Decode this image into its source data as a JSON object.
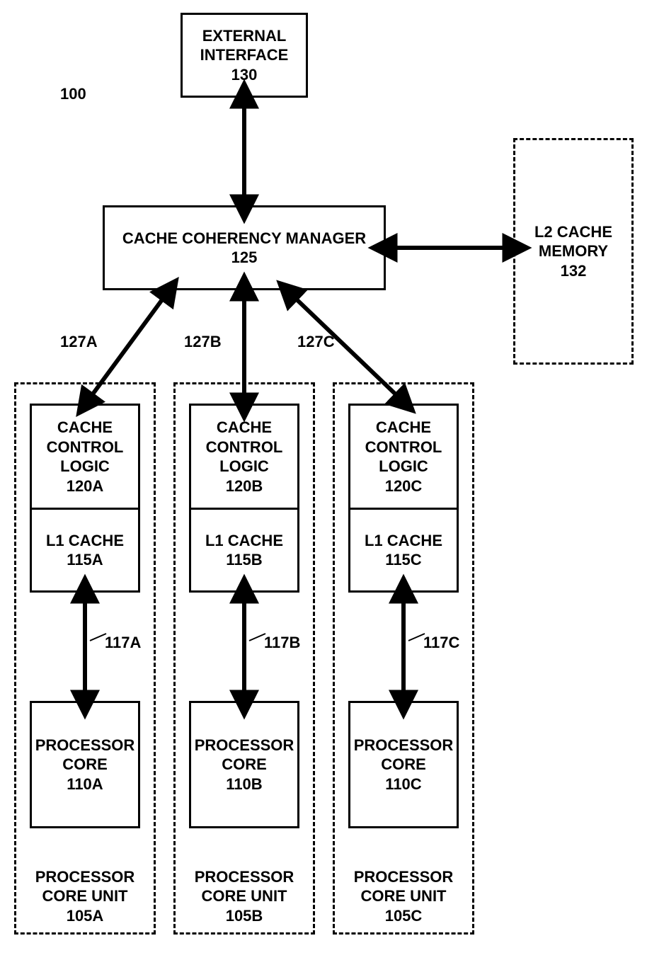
{
  "diagram_id": "100",
  "blocks": {
    "external_interface": {
      "title": "EXTERNAL INTERFACE",
      "ref": "130"
    },
    "cache_coherency_manager": {
      "title": "CACHE COHERENCY MANAGER",
      "ref": "125"
    },
    "l2_cache": {
      "title": "L2 CACHE MEMORY",
      "ref": "132"
    },
    "units": [
      {
        "cache_control": {
          "title": "CACHE CONTROL LOGIC",
          "ref": "120A"
        },
        "l1_cache": {
          "title": "L1 CACHE",
          "ref": "115A"
        },
        "processor_core": {
          "title": "PROCESSOR CORE",
          "ref": "110A"
        },
        "unit": {
          "title": "PROCESSOR CORE UNIT",
          "ref": "105A"
        },
        "arrow_top": "127A",
        "arrow_mid": "117A"
      },
      {
        "cache_control": {
          "title": "CACHE CONTROL LOGIC",
          "ref": "120B"
        },
        "l1_cache": {
          "title": "L1 CACHE",
          "ref": "115B"
        },
        "processor_core": {
          "title": "PROCESSOR CORE",
          "ref": "110B"
        },
        "unit": {
          "title": "PROCESSOR CORE UNIT",
          "ref": "105B"
        },
        "arrow_top": "127B",
        "arrow_mid": "117B"
      },
      {
        "cache_control": {
          "title": "CACHE CONTROL LOGIC",
          "ref": "120C"
        },
        "l1_cache": {
          "title": "L1 CACHE",
          "ref": "115C"
        },
        "processor_core": {
          "title": "PROCESSOR CORE",
          "ref": "110C"
        },
        "unit": {
          "title": "PROCESSOR CORE UNIT",
          "ref": "105C"
        },
        "arrow_top": "127C",
        "arrow_mid": "117C"
      }
    ]
  }
}
